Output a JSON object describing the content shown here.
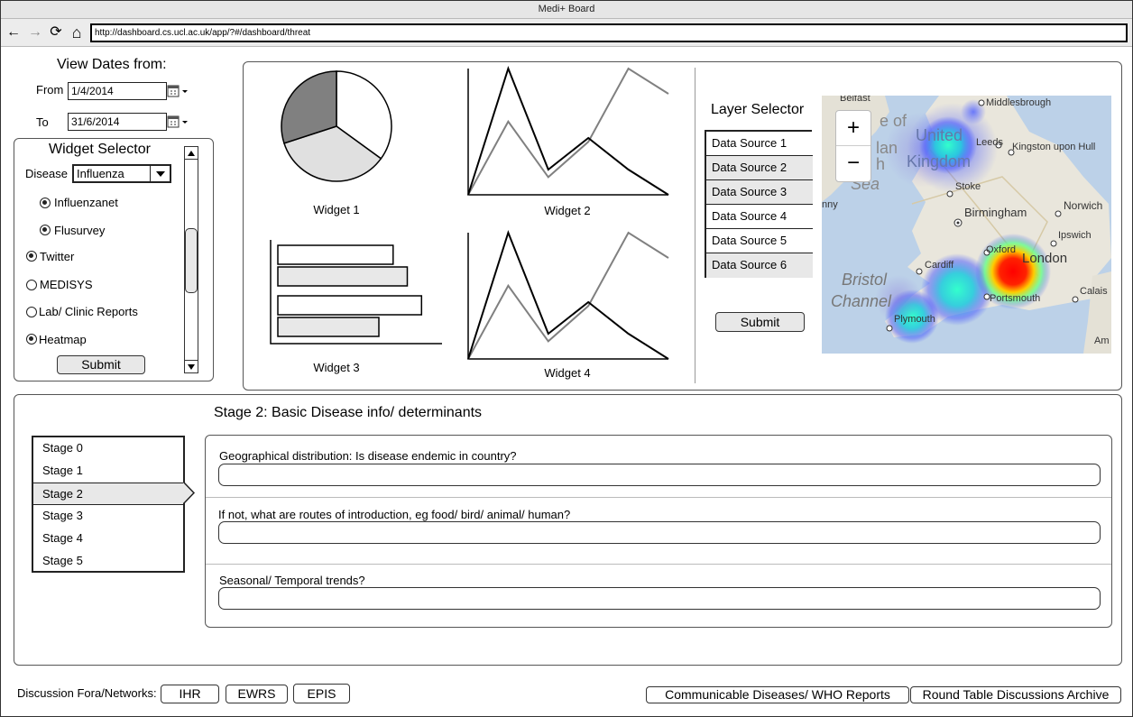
{
  "window": {
    "title": "Medi+ Board"
  },
  "toolbar": {
    "back_icon": "←",
    "forward_icon": "→",
    "reload_icon": "⟳",
    "home_icon": "⌂",
    "url": "http://dashboard.cs.ucl.ac.uk/app/?#/dashboard/threat"
  },
  "dates": {
    "heading": "View Dates from:",
    "from_label": "From",
    "from_value": "1/4/2014",
    "to_label": "To",
    "to_value": "31/6/2014"
  },
  "widget_selector": {
    "title": "Widget Selector",
    "disease_label": "Disease",
    "disease_value": "Influenza",
    "options": [
      {
        "label": "Influenzanet",
        "selected": false
      },
      {
        "label": "Flusurvey",
        "selected": true
      },
      {
        "label": "Twitter",
        "selected": true
      },
      {
        "label": "MEDISYS",
        "selected": false
      },
      {
        "label": "Lab/ Clinic Reports",
        "selected": false
      },
      {
        "label": "Heatmap",
        "selected": true
      }
    ],
    "submit_label": "Submit"
  },
  "widgets": {
    "w1_caption": "Widget 1",
    "w2_caption": "Widget 2",
    "w3_caption": "Widget 3",
    "w4_caption": "Widget 4"
  },
  "layer_selector": {
    "title": "Layer Selector",
    "sources": [
      {
        "label": "Data Source 1",
        "selected": false
      },
      {
        "label": "Data Source 2",
        "selected": true
      },
      {
        "label": "Data Source 3",
        "selected": true
      },
      {
        "label": "Data Source 4",
        "selected": false
      },
      {
        "label": "Data Source 5",
        "selected": false
      },
      {
        "label": "Data Source 6",
        "selected": true
      }
    ],
    "submit_label": "Submit"
  },
  "map": {
    "zoom_in": "+",
    "zoom_out": "−",
    "places": {
      "belfast": "Belfast",
      "middlesbrough": "Middlesbrough",
      "isle_of": "e of",
      "united": "United",
      "kingdom": "Kingdom",
      "leeds": "Leeds",
      "kingston": "Kingston upon Hull",
      "ian": "lan",
      "h": "h",
      "sea": "Sea",
      "stoke": "Stoke",
      "nny": "nny",
      "birmingham": "Birmingham",
      "norwich": "Norwich",
      "ipswich": "Ipswich",
      "oxford": "Oxford",
      "london": "London",
      "cardiff": "Cardiff",
      "bristol": "Bristol",
      "channel": "Channel",
      "portsmouth": "Portsmouth",
      "calais": "Calais",
      "plymouth": "Plymouth",
      "am": "Am"
    }
  },
  "stage": {
    "title": "Stage 2: Basic Disease info/ determinants",
    "list": [
      "Stage 0",
      "Stage 1",
      "Stage 2",
      "Stage 3",
      "Stage 4",
      "Stage 5"
    ],
    "active_index": 2,
    "questions": [
      {
        "label": "Geographical distribution: Is disease endemic in country?",
        "value": ""
      },
      {
        "label": "If not, what are routes of introduction, eg food/ bird/ animal/ human?",
        "value": ""
      },
      {
        "label": "Seasonal/ Temporal trends?",
        "value": ""
      }
    ]
  },
  "footer": {
    "label": "Discussion Fora/Networks:",
    "networks": [
      "IHR",
      "EWRS",
      "EPIS"
    ],
    "who_reports": "Communicable Diseases/ WHO Reports",
    "round_table": "Round Table Discussions Archive"
  },
  "chart_data": [
    {
      "type": "pie",
      "values": [
        35,
        35,
        30
      ],
      "colors": [
        "#ffffff",
        "#e0e0e0",
        "#808080"
      ]
    },
    {
      "type": "line",
      "x": [
        0,
        1,
        2,
        3,
        4,
        5
      ],
      "series": [
        {
          "values": [
            0,
            100,
            20,
            45,
            20,
            0
          ],
          "color": "#000000"
        },
        {
          "values": [
            0,
            58,
            14,
            42,
            100,
            80
          ],
          "color": "#808080"
        }
      ]
    },
    {
      "type": "bar",
      "series": [
        {
          "values": [
            73,
            91
          ],
          "color": "#ffffff"
        },
        {
          "values": [
            82,
            64
          ],
          "color": "#e8e8e8"
        }
      ]
    },
    {
      "type": "line",
      "x": [
        0,
        1,
        2,
        3,
        4,
        5
      ],
      "series": [
        {
          "values": [
            0,
            100,
            20,
            45,
            20,
            0
          ],
          "color": "#000000"
        },
        {
          "values": [
            0,
            58,
            14,
            42,
            100,
            80
          ],
          "color": "#808080"
        }
      ]
    }
  ]
}
